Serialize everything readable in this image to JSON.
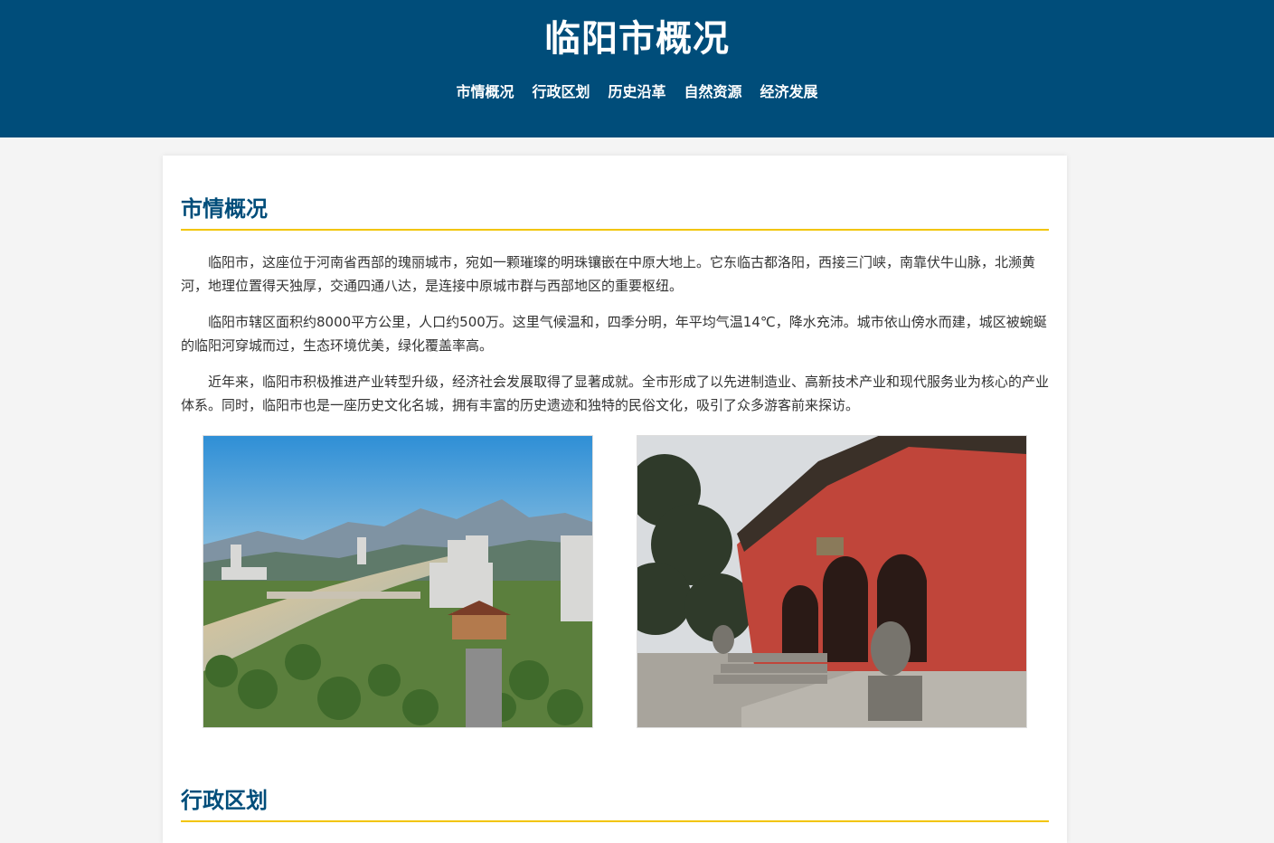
{
  "header": {
    "title": "临阳市概况",
    "nav": [
      "市情概况",
      "行政区划",
      "历史沿革",
      "自然资源",
      "经济发展"
    ]
  },
  "sections": {
    "overview": {
      "heading": "市情概况",
      "paragraphs": [
        "临阳市，这座位于河南省西部的瑰丽城市，宛如一颗璀璨的明珠镶嵌在中原大地上。它东临古都洛阳，西接三门峡，南靠伏牛山脉，北濒黄河，地理位置得天独厚，交通四通八达，是连接中原城市群与西部地区的重要枢纽。",
        "临阳市辖区面积约8000平方公里，人口约500万。这里气候温和，四季分明，年平均气温14℃，降水充沛。城市依山傍水而建，城区被蜿蜒的临阳河穿城而过，生态环境优美，绿化覆盖率高。",
        "近年来，临阳市积极推进产业转型升级，经济社会发展取得了显著成就。全市形成了以先进制造业、高新技术产业和现代服务业为核心的产业体系。同时，临阳市也是一座历史文化名城，拥有丰富的历史遗迹和独特的民俗文化，吸引了众多游客前来探访。"
      ]
    },
    "admin": {
      "heading": "行政区划"
    }
  },
  "colors": {
    "header_bg": "#004d7a",
    "accent": "#f2c500",
    "heading": "#004d7a"
  }
}
